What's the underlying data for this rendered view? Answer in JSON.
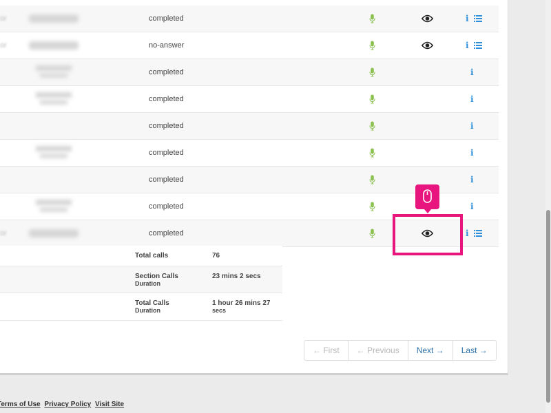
{
  "calls": {
    "rows": [
      {
        "prefix": "or",
        "blur": "one",
        "status": "completed",
        "eye": true,
        "list": true
      },
      {
        "prefix": "or",
        "blur": "one",
        "status": "no-answer",
        "eye": true,
        "list": true
      },
      {
        "prefix": "",
        "blur": "two",
        "status": "completed",
        "eye": false,
        "list": false
      },
      {
        "prefix": "",
        "blur": "two",
        "status": "completed",
        "eye": false,
        "list": false
      },
      {
        "prefix": "",
        "blur": "none",
        "status": "completed",
        "eye": false,
        "list": false
      },
      {
        "prefix": "",
        "blur": "two",
        "status": "completed",
        "eye": false,
        "list": false
      },
      {
        "prefix": "",
        "blur": "none",
        "status": "completed",
        "eye": false,
        "list": false
      },
      {
        "prefix": "",
        "blur": "two",
        "status": "completed",
        "eye": false,
        "list": false
      },
      {
        "prefix": "or",
        "blur": "one",
        "status": "completed",
        "eye": true,
        "list": true
      }
    ],
    "icons": {
      "recording": "microphone-icon",
      "view": "eye-icon",
      "info": "info-icon",
      "details": "list-icon"
    },
    "info_glyph": "i"
  },
  "totals": {
    "total_calls_label": "Total calls",
    "total_calls_value": "76",
    "section_label_line1": "Section Calls",
    "section_label_line2": "Duration",
    "section_value": "23 mins 2 secs",
    "total_duration_label_line1": "Total Calls",
    "total_duration_label_line2": "Duration",
    "total_duration_value_line1": "1 hour 26 mins 27",
    "total_duration_value_line2": "secs"
  },
  "pagination": {
    "first": "← First",
    "previous": "← Previous",
    "next": "Next →",
    "last": "Last →"
  },
  "footer": {
    "terms": "Terms of Use",
    "privacy": "Privacy Policy",
    "visit": "Visit Site"
  },
  "colors": {
    "accent": "#e8157f",
    "mic": "#8cc152",
    "info": "#2f8fd8",
    "link": "#2a6fa8"
  }
}
